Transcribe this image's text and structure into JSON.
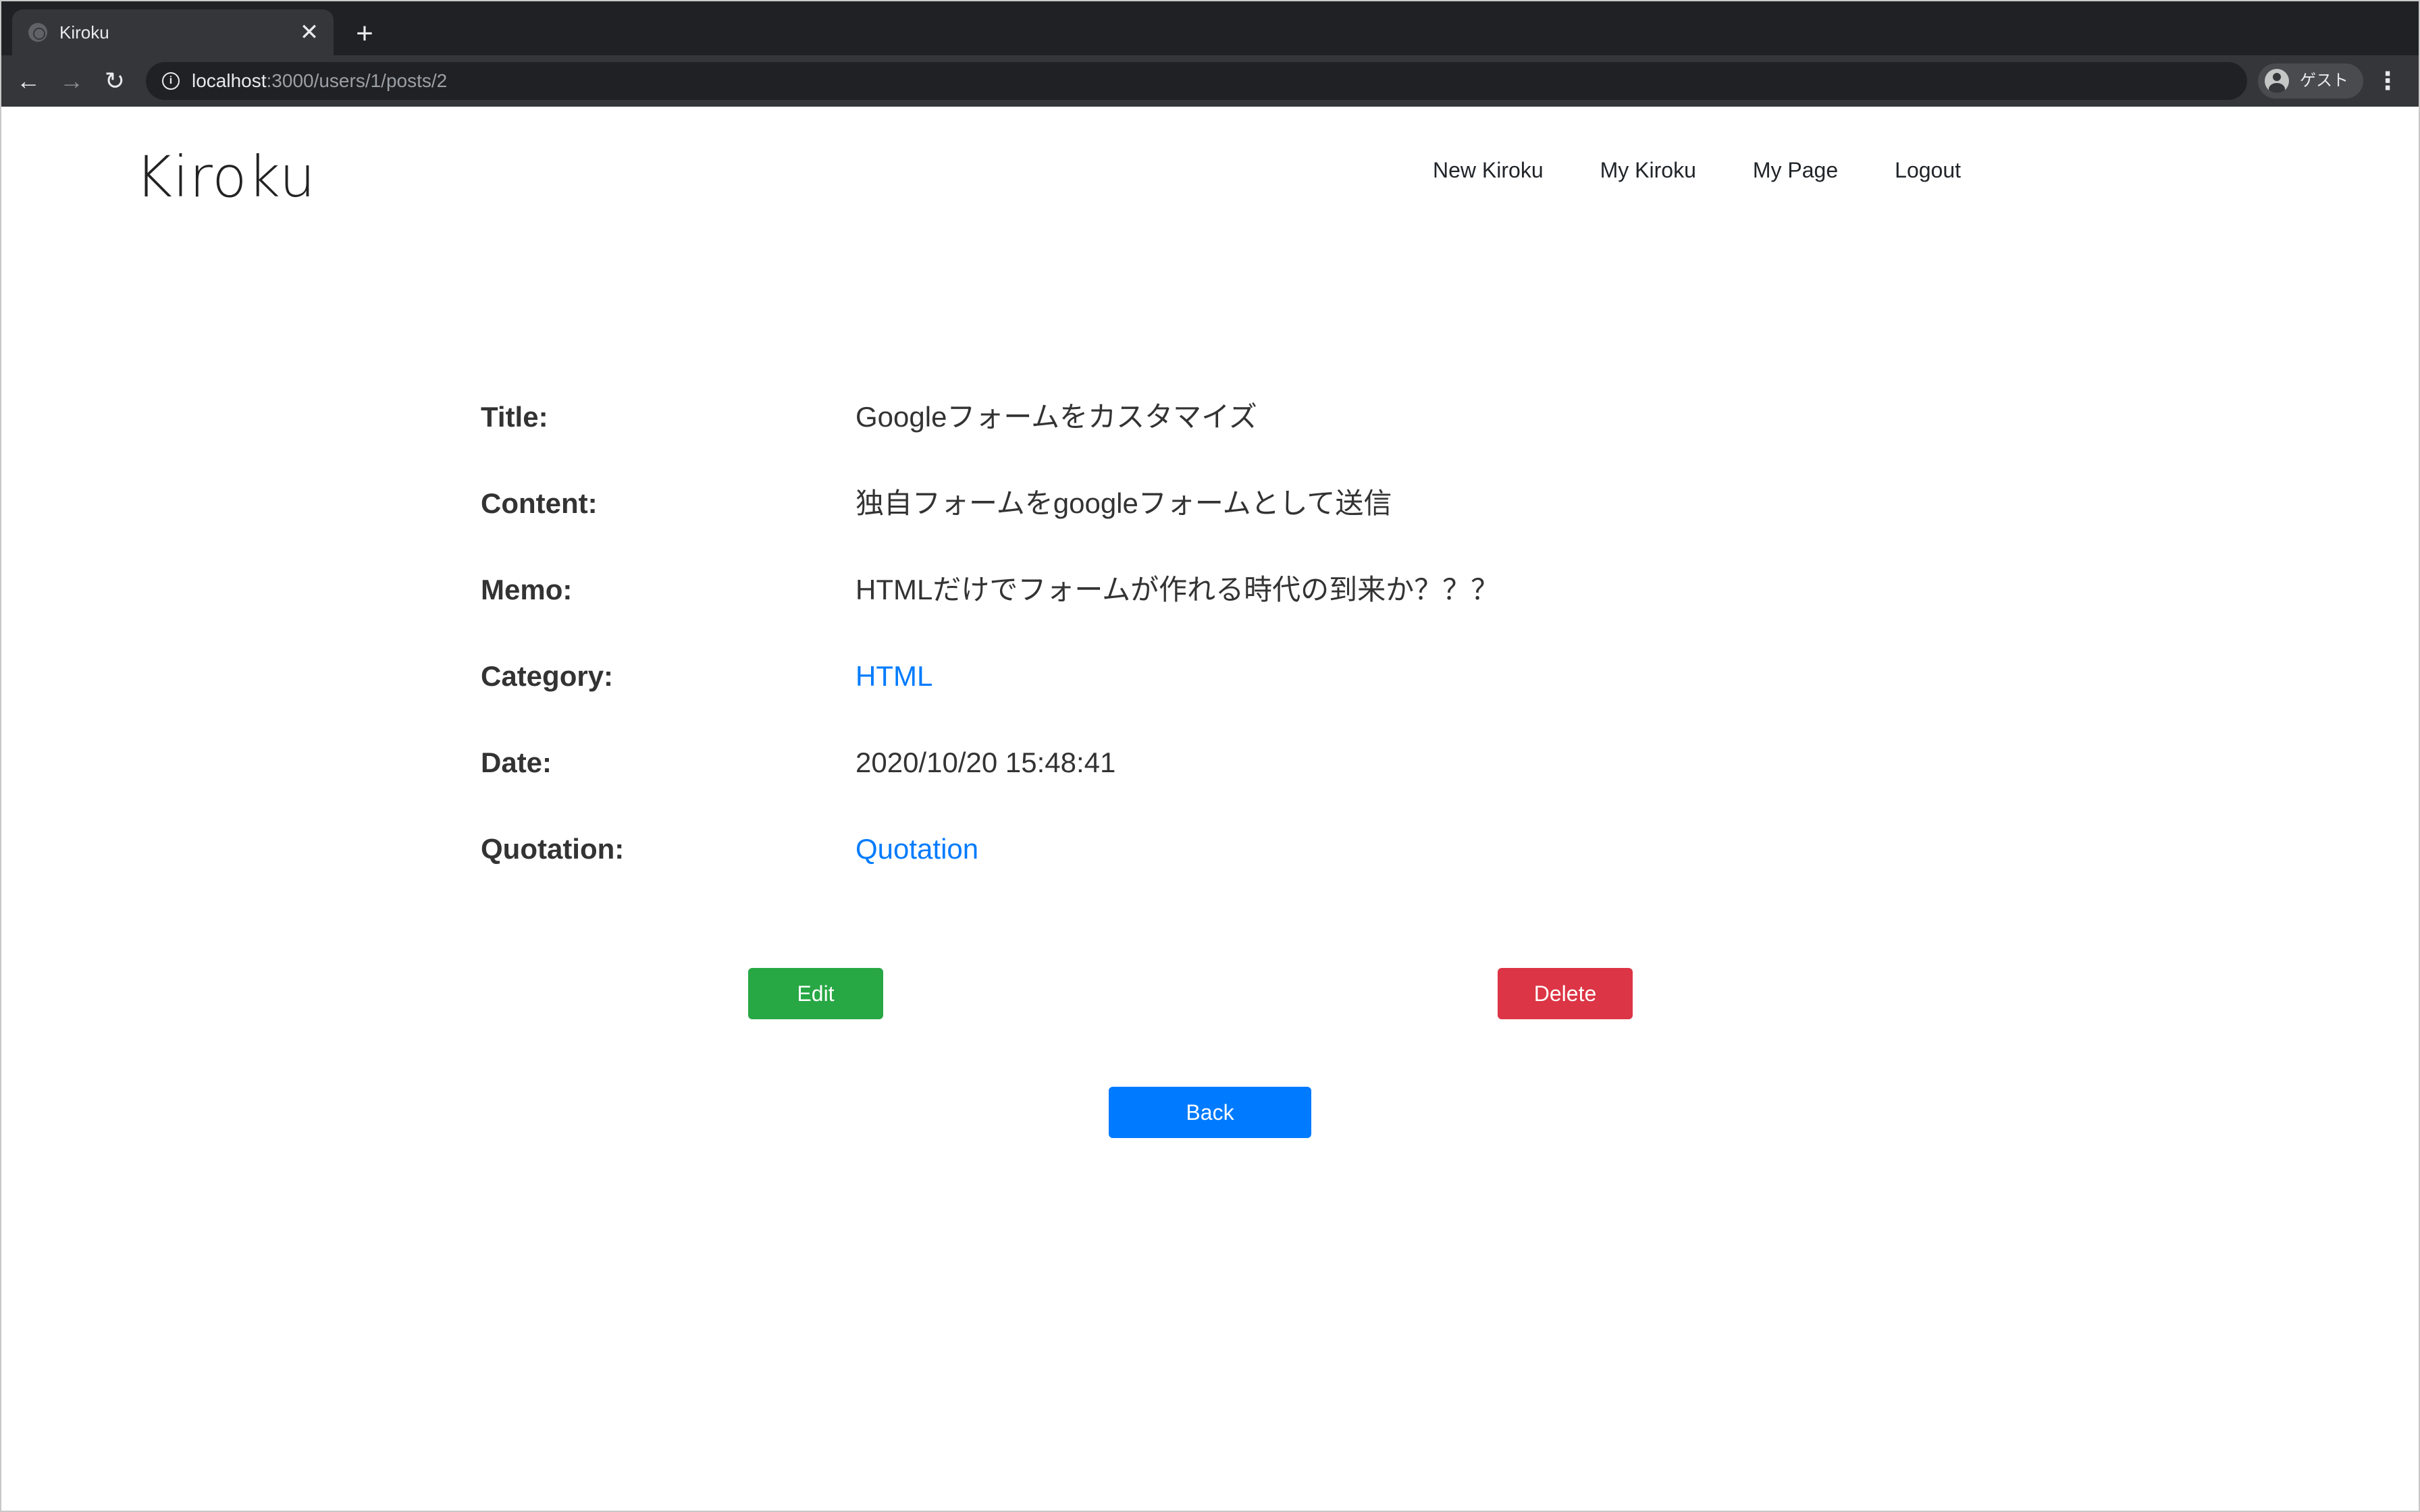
{
  "browser": {
    "tab_title": "Kiroku",
    "tab_close": "✕",
    "new_tab": "+",
    "url_host": "localhost",
    "url_path": ":3000/users/1/posts/2",
    "profile_label": "ゲスト",
    "back": "←",
    "forward": "→",
    "reload": "↻",
    "menu": "⋮"
  },
  "header": {
    "brand": "Kiroku",
    "nav": [
      "New Kiroku",
      "My Kiroku",
      "My Page",
      "Logout"
    ]
  },
  "post": {
    "title_label": "Title:",
    "title_value": "Googleフォームをカスタマイズ",
    "content_label": "Content:",
    "content_value": "独自フォームをgoogleフォームとして送信",
    "memo_label": "Memo:",
    "memo_value": "HTMLだけでフォームが作れる時代の到来か？？？",
    "category_label": "Category:",
    "category_value": "HTML",
    "date_label": "Date:",
    "date_value": "2020/10/20 15:48:41",
    "quotation_label": "Quotation:",
    "quotation_value": "Quotation"
  },
  "actions": {
    "edit": "Edit",
    "delete": "Delete",
    "back": "Back"
  },
  "colors": {
    "edit": "#28a745",
    "delete": "#dc3545",
    "back": "#007bff",
    "link": "#007bff"
  }
}
